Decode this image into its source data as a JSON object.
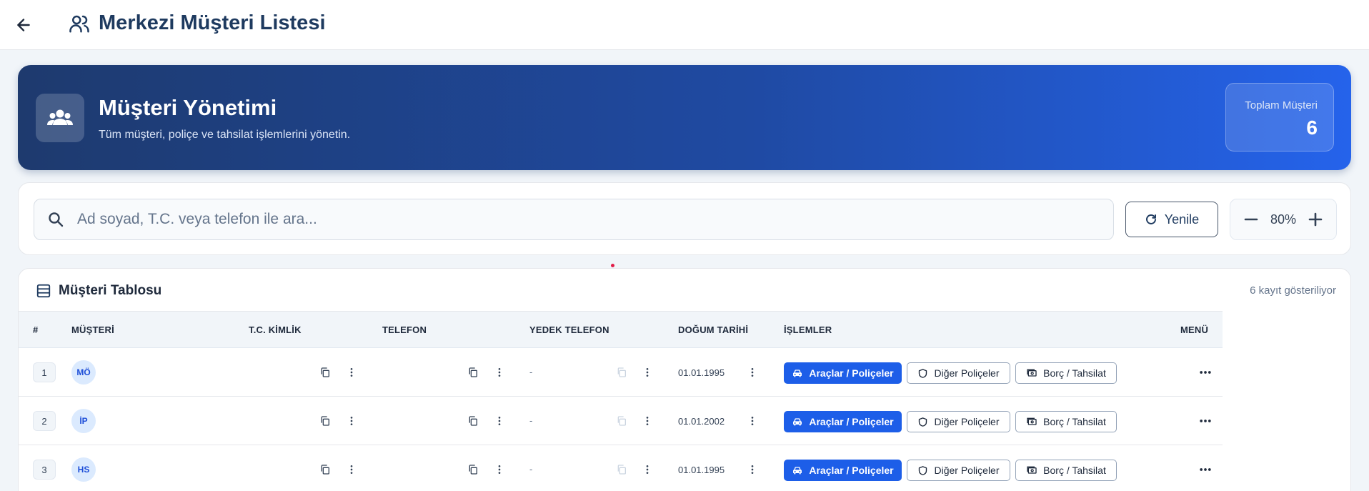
{
  "header": {
    "title": "Merkezi Müşteri Listesi",
    "back_icon": "arrow-left-icon",
    "title_icon": "users-icon"
  },
  "hero": {
    "title": "Müşteri Yönetimi",
    "subtitle": "Tüm müşteri, poliçe ve tahsilat işlemlerini yönetin.",
    "icon": "user-group-icon",
    "stat_label": "Toplam Müşteri",
    "stat_value": "6"
  },
  "search": {
    "placeholder": "Ad soyad, T.C. veya telefon ile ara...",
    "value": ""
  },
  "toolbar": {
    "refresh_label": "Yenile",
    "zoom_value": "80%"
  },
  "table": {
    "title": "Müşteri Tablosu",
    "record_count": "6 kayıt gösteriliyor",
    "columns": [
      "#",
      "MÜŞTERİ",
      "T.C. KİMLİK",
      "TELEFON",
      "YEDEK TELEFON",
      "DOĞUM TARİHİ",
      "İŞLEMLER",
      "MENÜ"
    ],
    "rows": [
      {
        "index": "1",
        "initials": "MÖ",
        "backup_phone": "-",
        "birth_date": "01.01.1995"
      },
      {
        "index": "2",
        "initials": "İP",
        "backup_phone": "-",
        "birth_date": "01.01.2002"
      },
      {
        "index": "3",
        "initials": "HS",
        "backup_phone": "-",
        "birth_date": "01.01.1995"
      }
    ],
    "actions": {
      "vehicles": "Araçlar / Poliçeler",
      "other": "Diğer Poliçeler",
      "debt": "Borç / Tahsilat"
    }
  },
  "colors": {
    "primary": "#1d5ee8",
    "hero_start": "#1e3a6e",
    "hero_end": "#2563eb",
    "title": "#1e3a5f"
  }
}
